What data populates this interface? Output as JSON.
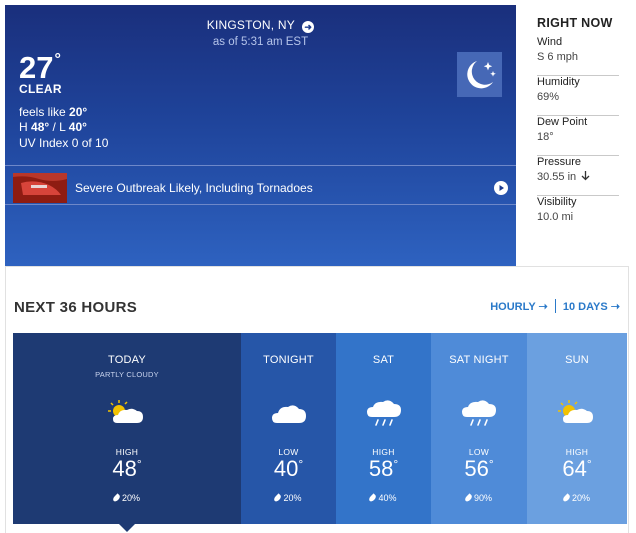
{
  "current": {
    "location": "KINGSTON, NY",
    "as_of": "as of 5:31 am EST",
    "temperature": "27",
    "condition": "CLEAR",
    "feels_like_label": "feels like",
    "feels_like_value": "20°",
    "high_label": "H",
    "high_value": "48°",
    "low_separator": "/ L",
    "low_value": "40°",
    "uv_index": "UV Index 0 of 10",
    "icon": "clear-night-moon-icon",
    "news": {
      "headline": "Severe Outbreak Likely, Including Tornadoes",
      "icon": "play-icon"
    }
  },
  "right_now": {
    "title": "RIGHT NOW",
    "items": [
      {
        "label": "Wind",
        "value": "S 6 mph"
      },
      {
        "label": "Humidity",
        "value": "69%"
      },
      {
        "label": "Dew Point",
        "value": "18°"
      },
      {
        "label": "Pressure",
        "value": "30.55 in",
        "trend_icon": "arrow-down-icon"
      },
      {
        "label": "Visibility",
        "value": "10.0 mi"
      }
    ]
  },
  "next_36": {
    "title": "NEXT 36 HOURS",
    "hourly_label": "HOURLY",
    "ten_day_label": "10 DAYS",
    "periods": [
      {
        "name": "TODAY",
        "sub": "PARTLY CLOUDY",
        "icon": "partly-cloudy-icon",
        "hl_label": "HIGH",
        "temp": "48",
        "precip": "20%",
        "color": "#1e3a73"
      },
      {
        "name": "TONIGHT",
        "sub": "",
        "icon": "cloudy-icon",
        "hl_label": "LOW",
        "temp": "40",
        "precip": "20%",
        "color": "#2656a8"
      },
      {
        "name": "SAT",
        "sub": "",
        "icon": "rain-icon",
        "hl_label": "HIGH",
        "temp": "58",
        "precip": "40%",
        "color": "#3374c9"
      },
      {
        "name": "SAT NIGHT",
        "sub": "",
        "icon": "rain-icon",
        "hl_label": "LOW",
        "temp": "56",
        "precip": "90%",
        "color": "#4f8bd8"
      },
      {
        "name": "SUN",
        "sub": "",
        "icon": "partly-cloudy-icon",
        "hl_label": "HIGH",
        "temp": "64",
        "precip": "20%",
        "color": "#6ba0e0"
      }
    ]
  }
}
